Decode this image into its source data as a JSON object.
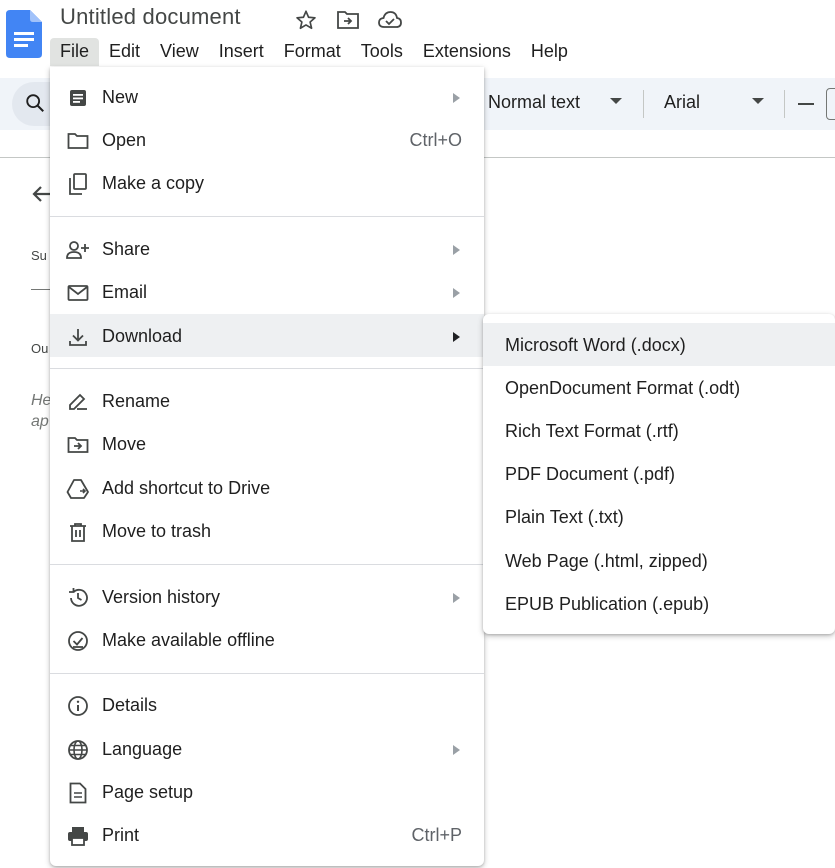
{
  "document": {
    "title": "Untitled document"
  },
  "menubar": {
    "items": [
      "File",
      "Edit",
      "View",
      "Insert",
      "Format",
      "Tools",
      "Extensions",
      "Help"
    ]
  },
  "toolbar": {
    "style": "Normal text",
    "font": "Arial"
  },
  "outline": {
    "summary_abbr": "Su",
    "outline_abbr": "Ou",
    "hint_line1": "He",
    "hint_line2": "ap"
  },
  "file_menu": {
    "items": [
      {
        "label": "New",
        "icon": "doc-icon",
        "submenu": true
      },
      {
        "label": "Open",
        "icon": "folder-icon",
        "shortcut": "Ctrl+O"
      },
      {
        "label": "Make a copy",
        "icon": "copy-icon"
      },
      {
        "label": "Share",
        "icon": "person-add-icon",
        "submenu": true
      },
      {
        "label": "Email",
        "icon": "mail-icon",
        "submenu": true
      },
      {
        "label": "Download",
        "icon": "download-icon",
        "submenu": true,
        "highlighted": true
      },
      {
        "label": "Rename",
        "icon": "rename-icon"
      },
      {
        "label": "Move",
        "icon": "move-folder-icon"
      },
      {
        "label": "Add shortcut to Drive",
        "icon": "drive-shortcut-icon"
      },
      {
        "label": "Move to trash",
        "icon": "trash-icon"
      },
      {
        "label": "Version history",
        "icon": "history-icon",
        "submenu": true
      },
      {
        "label": "Make available offline",
        "icon": "offline-icon"
      },
      {
        "label": "Details",
        "icon": "info-icon"
      },
      {
        "label": "Language",
        "icon": "globe-icon",
        "submenu": true
      },
      {
        "label": "Page setup",
        "icon": "page-icon"
      },
      {
        "label": "Print",
        "icon": "print-icon",
        "shortcut": "Ctrl+P"
      }
    ]
  },
  "download_menu": {
    "items": [
      "Microsoft Word (.docx)",
      "OpenDocument Format (.odt)",
      "Rich Text Format (.rtf)",
      "PDF Document (.pdf)",
      "Plain Text (.txt)",
      "Web Page (.html, zipped)",
      "EPUB Publication (.epub)"
    ]
  },
  "colors": {
    "docs_blue": "#4285f4",
    "menu_highlight": "#eef0f2",
    "toolbar_bg": "#f0f4f9"
  }
}
